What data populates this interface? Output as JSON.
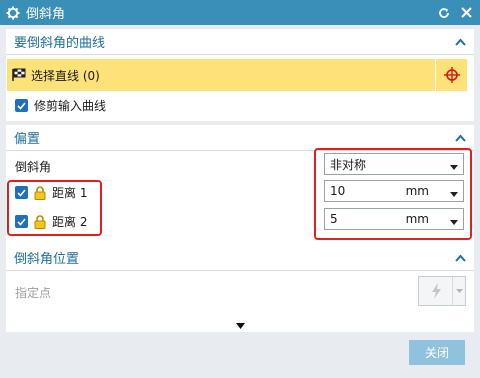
{
  "window": {
    "title": "倒斜角"
  },
  "section_curves": {
    "header": "要倒斜角的曲线",
    "select_label": "选择直线 (0)",
    "trim_label": "修剪输入曲线",
    "trim_checked": true
  },
  "section_offset": {
    "header": "偏置",
    "chamfer_label": "倒斜角",
    "chamfer_value": "非对称",
    "dist1_label": "距离 1",
    "dist1_value": "10",
    "dist1_unit": "mm",
    "dist2_label": "距离 2",
    "dist2_value": "5",
    "dist2_unit": "mm"
  },
  "section_position": {
    "header": "倒斜角位置",
    "point_label": "指定点"
  },
  "footer": {
    "close_label": "关闭"
  },
  "colors": {
    "titlebar": "#3a8fb8",
    "accent": "#1f6f9a",
    "highlight": "#fde27a",
    "annotation": "#e02020"
  }
}
